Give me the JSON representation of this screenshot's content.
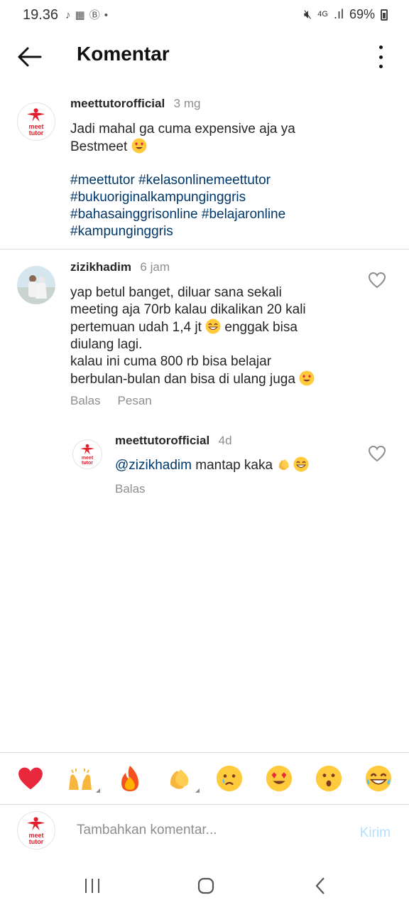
{
  "status": {
    "time": "19.36",
    "net": "4G",
    "battery": "69%"
  },
  "header": {
    "title": "Komentar"
  },
  "caption": {
    "username": "meettutorofficial",
    "time": "3 mg",
    "text": "Jadi mahal ga cuma expensive aja ya Bestmeet",
    "hashtags": [
      "#meettutor",
      "#kelasonlinemeettutor",
      "#bukuoriginalkampunginggris",
      "#bahasainggrisonline",
      "#belajaronline",
      "#kampunginggris"
    ],
    "logo_text_top": "meet",
    "logo_text_bottom": "tutor"
  },
  "comments": [
    {
      "username": "zizikhadim",
      "time": "6 jam",
      "text_part1": "yap betul banget, diluar sana sekali meeting aja 70rb kalau dikalikan 20 kali pertemuan udah 1,4 jt",
      "text_part2": "enggak bisa diulang lagi.",
      "text_part3": "kalau ini cuma 800 rb bisa belajar berbulan-bulan dan bisa di ulang juga",
      "reply_label": "Balas",
      "message_label": "Pesan"
    }
  ],
  "reply": {
    "username": "meettutorofficial",
    "time": "4d",
    "mention": "@zizikhadim",
    "text": "mantap kaka",
    "reply_label": "Balas"
  },
  "emoji_bar": [
    "heart",
    "raising-hands",
    "fire",
    "clapping-hands",
    "crying-face",
    "heart-eyes-face",
    "surprised-face",
    "laughing-tears-face"
  ],
  "input": {
    "placeholder": "Tambahkan komentar...",
    "send_label": "Kirim"
  },
  "colors": {
    "brand_red": "#e0202e",
    "link": "#00376b",
    "send_disabled": "#b2dffc",
    "secondary_text": "#8e8e8e"
  }
}
